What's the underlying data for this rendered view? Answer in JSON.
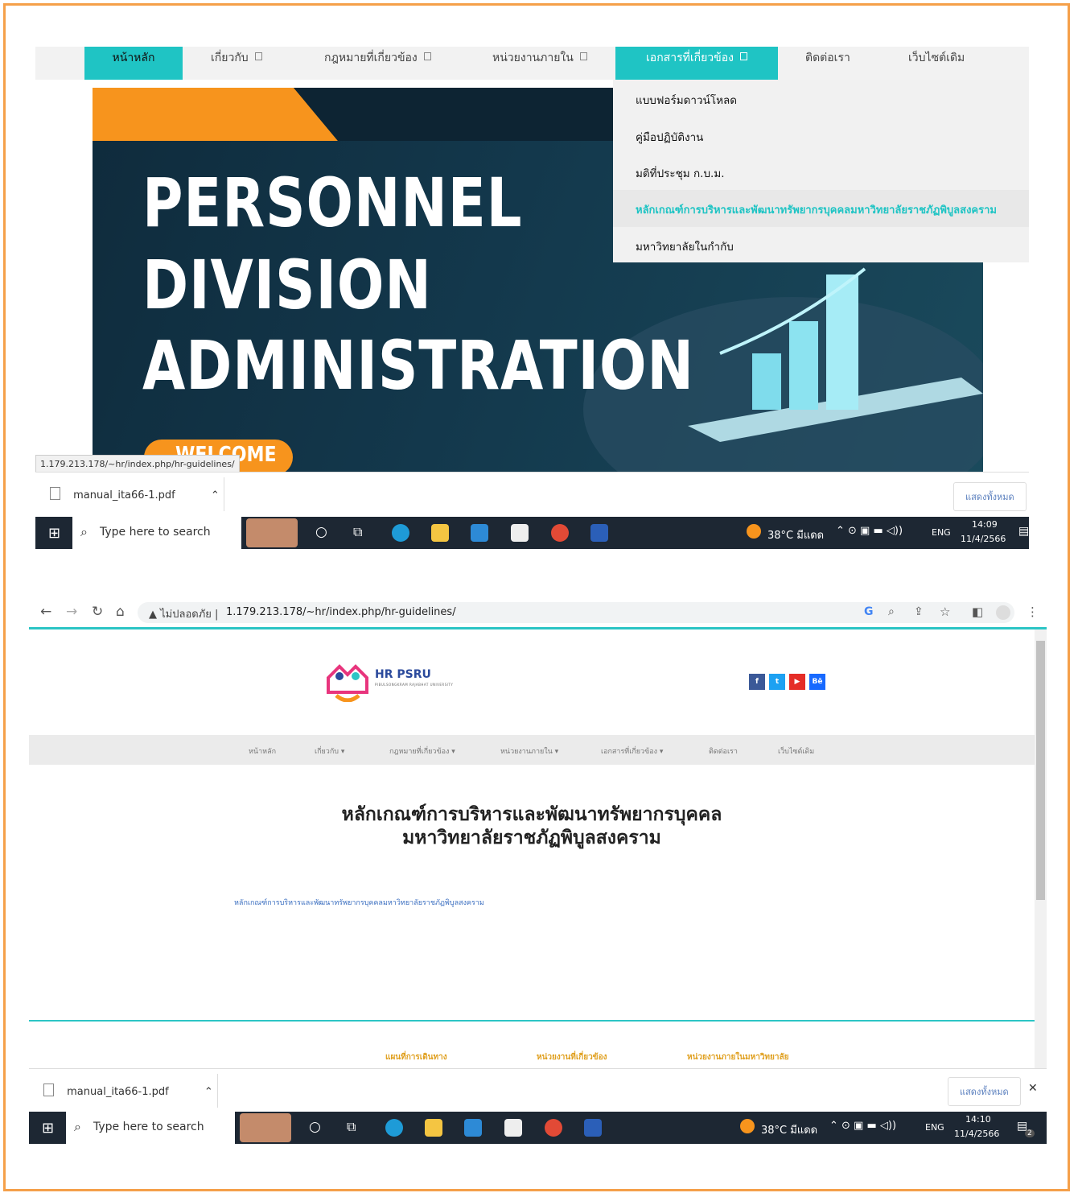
{
  "top": {
    "nav": {
      "home": "หน้าหลัก",
      "about": "เกี่ยวกับ",
      "laws": "กฎหมายที่เกี่ยวข้อง",
      "units": "หน่วยงานภายใน",
      "docs": "เอกสารที่เกี่ยวข้อง",
      "contact": "ติดต่อเรา",
      "oldsite": "เว็บไซต์เดิม"
    },
    "dropdown": [
      "แบบฟอร์มดาวน์โหลด",
      "คู่มือปฏิบัติงาน",
      "มติที่ประชุม ก.บ.ม.",
      "หลักเกณฑ์การบริหารและพัฒนาทรัพยากรบุคคลมหาวิทยาลัยราชภัฏพิบูลสงคราม",
      "มหาวิทยาลัยในกำกับ"
    ],
    "hero": {
      "line1": "PERSONNEL",
      "line2": "DIVISION",
      "line3": "ADMINISTRATION",
      "welcome": "WELCOME"
    },
    "status_url": "1.179.213.178/~hr/index.php/hr-guidelines/",
    "download": {
      "file": "manual_ita66-1.pdf",
      "show_all": "แสดงทั้งหมด"
    },
    "taskbar": {
      "search": "Type here to search",
      "weather": "38°C มีแดด",
      "lang": "ENG",
      "time": "14:09",
      "date": "11/4/2566"
    }
  },
  "bottom": {
    "browser": {
      "warning": "ไม่ปลอดภัย",
      "url": "1.179.213.178/~hr/index.php/hr-guidelines/"
    },
    "logo": {
      "name": "HR PSRU",
      "sub": "PIBULSONGKRAM RAJABHAT UNIVERSITY"
    },
    "social": [
      "f",
      "t",
      "▶",
      "Bē"
    ],
    "nav": [
      "หน้าหลัก",
      "เกี่ยวกับ ▾",
      "กฎหมายที่เกี่ยวข้อง ▾",
      "หน่วยงานภายใน ▾",
      "เอกสารที่เกี่ยวข้อง ▾",
      "ติดต่อเรา",
      "เว็บไซต์เดิม"
    ],
    "title_line1": "หลักเกณฑ์การบริหารและพัฒนาทรัพยากรบุคคล",
    "title_line2": "มหาวิทยาลัยราชภัฏพิบูลสงคราม",
    "doc_link": "หลักเกณฑ์การบริหารและพัฒนาทรัพยากรบุคคลมหาวิทยาลัยราชภัฏพิบูลสงคราม",
    "footer_links": [
      "แผนที่การเดินทาง",
      "หน่วยงานที่เกี่ยวข้อง",
      "หน่วยงานภายในมหาวิทยาลัย"
    ],
    "download": {
      "file": "manual_ita66-1.pdf",
      "show_all": "แสดงทั้งหมด"
    },
    "taskbar": {
      "search": "Type here to search",
      "weather": "38°C มีแดด",
      "lang": "ENG",
      "time": "14:10",
      "date": "11/4/2566",
      "notif": "2"
    }
  }
}
